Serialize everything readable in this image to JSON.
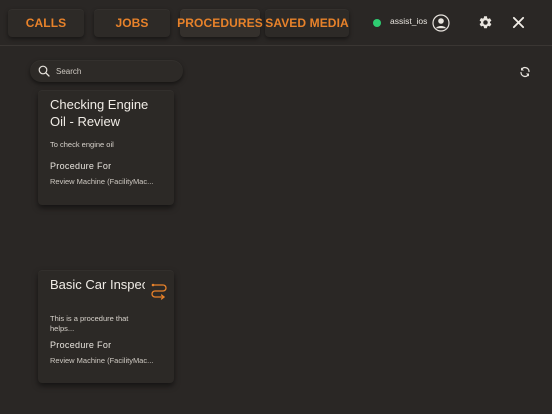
{
  "nav": {
    "calls": "CALLS",
    "jobs": "JOBS",
    "procedures": "PROCEDURES",
    "saved_media": "SAVED MEDIA",
    "active": "procedures"
  },
  "user": {
    "status": "online",
    "status_color": "#2ecc71",
    "name": "assist_ios"
  },
  "icons": {
    "avatar": "user-circle-icon",
    "settings": "gear-icon",
    "close": "close-icon",
    "search": "search-icon",
    "refresh": "refresh-icon",
    "procedure_flow": "flow-icon"
  },
  "search": {
    "placeholder": "Search",
    "value": ""
  },
  "colors": {
    "accent": "#e8822a",
    "background": "#2a2725",
    "card": "#2c2926"
  },
  "procedures": [
    {
      "title": "Checking Engine Oil - Review",
      "description": "To check engine oil",
      "subheading": "Procedure For",
      "machine": "Review Machine (FacilityMac..."
    },
    {
      "title": "Basic Car Inspection (Ch...",
      "description": "This is a procedure that helps...",
      "subheading": "Procedure For",
      "machine": "Review Machine (FacilityMac..."
    }
  ]
}
